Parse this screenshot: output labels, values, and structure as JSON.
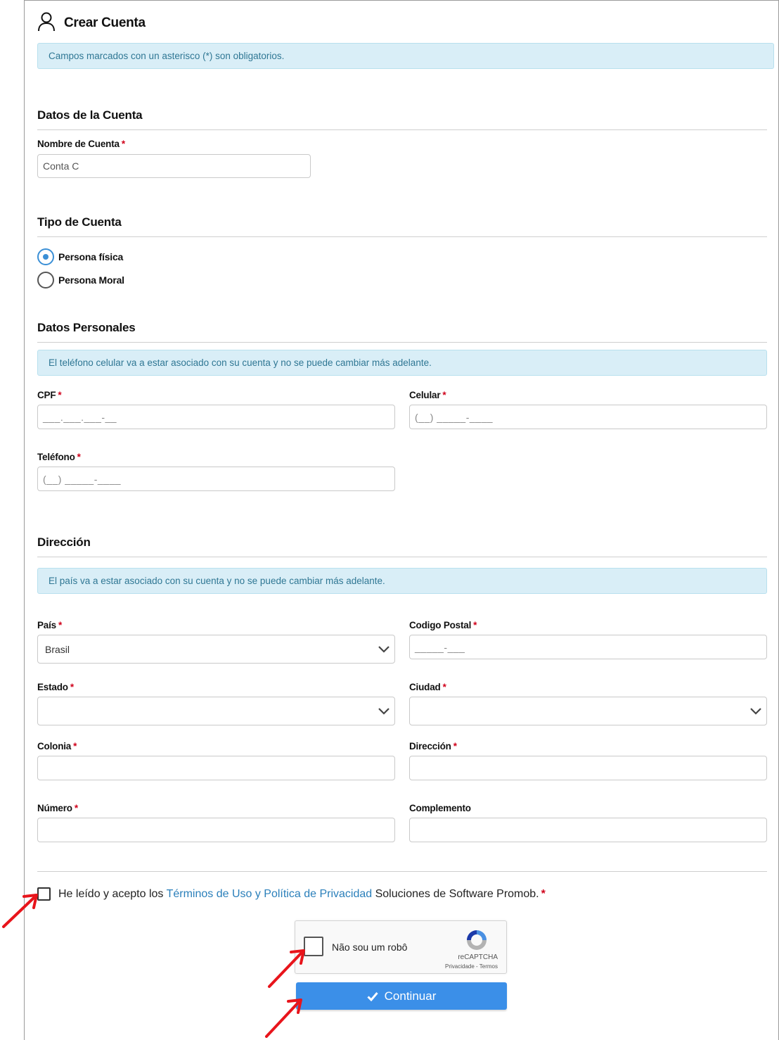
{
  "header": {
    "title": "Crear Cuenta",
    "icon": "user-icon"
  },
  "required_notice": "Campos marcados con un asterisco (*) son obligatorios.",
  "account": {
    "section_title": "Datos de la Cuenta",
    "name_label": "Nombre de Cuenta",
    "name_value": "Conta C"
  },
  "account_type": {
    "section_title": "Tipo de Cuenta",
    "options": [
      {
        "label": "Persona física",
        "checked": true
      },
      {
        "label": "Persona Moral",
        "checked": false
      }
    ]
  },
  "personal": {
    "section_title": "Datos Personales",
    "notice": "El teléfono celular va a estar asociado con su cuenta y no se puede cambiar más adelante.",
    "cpf_label": "CPF",
    "cpf_mask": "___.___.___-__",
    "cellular_label": "Celular",
    "cellular_mask": "(__) _____-____",
    "phone_label": "Teléfono",
    "phone_mask": "(__) _____-____"
  },
  "address": {
    "section_title": "Dirección",
    "notice": "El país va a estar asociado con su cuenta y no se puede cambiar más adelante.",
    "country_label": "País",
    "country_value": "Brasil",
    "postal_label": "Codigo Postal",
    "postal_mask": "_____-___",
    "state_label": "Estado",
    "state_value": "",
    "city_label": "Ciudad",
    "city_value": "",
    "colonia_label": "Colonia",
    "street_label": "Dirección",
    "number_label": "Número",
    "complement_label": "Complemento"
  },
  "terms": {
    "prefix": "He leído y acepto los",
    "link": "Términos de Uso y Política de Privacidad",
    "suffix": "Soluciones de Software Promob.",
    "required_mark": "*"
  },
  "recaptcha": {
    "label": "Não sou um robô",
    "brand": "reCAPTCHA",
    "links": "Privacidade - Termos"
  },
  "continue_button": {
    "label": "Continuar",
    "icon": "check-icon"
  },
  "required_mark": "*",
  "colors": {
    "accent": "#3b8fe8",
    "required": "#d0021b",
    "link": "#2a7fba",
    "alert_bg": "#d9eef7",
    "alert_text": "#2f7794",
    "annotation_arrow": "#e8141b"
  }
}
